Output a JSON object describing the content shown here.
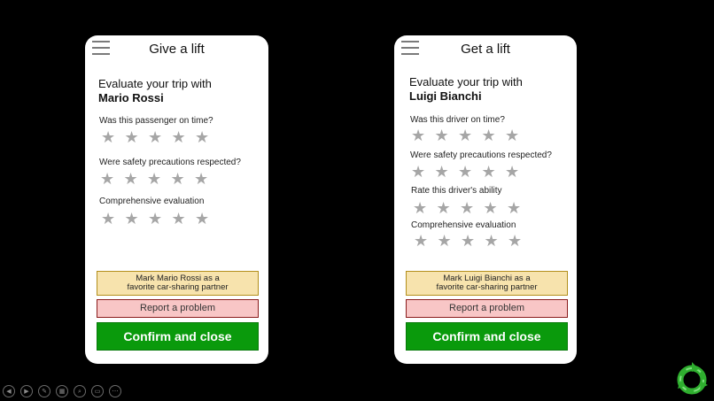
{
  "left_phone": {
    "title": "Give a lift",
    "evaluate_text": "Evaluate your trip with",
    "person_name": "Mario Rossi",
    "questions": [
      {
        "label": "Was this passenger on time?",
        "rating": 0
      },
      {
        "label": "Were safety precautions respected?",
        "rating": 0
      },
      {
        "label": "Comprehensive evaluation",
        "rating": 0
      }
    ],
    "favorite_line1": "Mark Mario Rossi as a",
    "favorite_line2": "favorite car-sharing partner",
    "report_label": "Report a problem",
    "confirm_label": "Confirm and close"
  },
  "right_phone": {
    "title": "Get a lift",
    "evaluate_text": "Evaluate your trip with",
    "person_name": "Luigi Bianchi",
    "questions": [
      {
        "label": "Was this driver on time?",
        "rating": 0
      },
      {
        "label": "Were safety precautions respected?",
        "rating": 0
      },
      {
        "label": "Rate this driver's ability",
        "rating": 0
      },
      {
        "label": "Comprehensive evaluation",
        "rating": 0
      }
    ],
    "favorite_line1": "Mark Luigi Bianchi as a",
    "favorite_line2": "favorite car-sharing partner",
    "report_label": "Report a problem",
    "confirm_label": "Confirm and close"
  },
  "star_glyph": "★",
  "max_stars": 5,
  "colors": {
    "star": "#a6a6a6",
    "favorite_bg": "#f7e3ad",
    "report_bg": "#f8c6c6",
    "confirm_bg": "#0a9a0c"
  },
  "toolbar_icons": [
    "previous-icon",
    "next-icon",
    "pen-icon",
    "slides-icon",
    "zoom-icon",
    "subtitles-icon",
    "more-icon"
  ],
  "corner_icon": "recycle-icon"
}
